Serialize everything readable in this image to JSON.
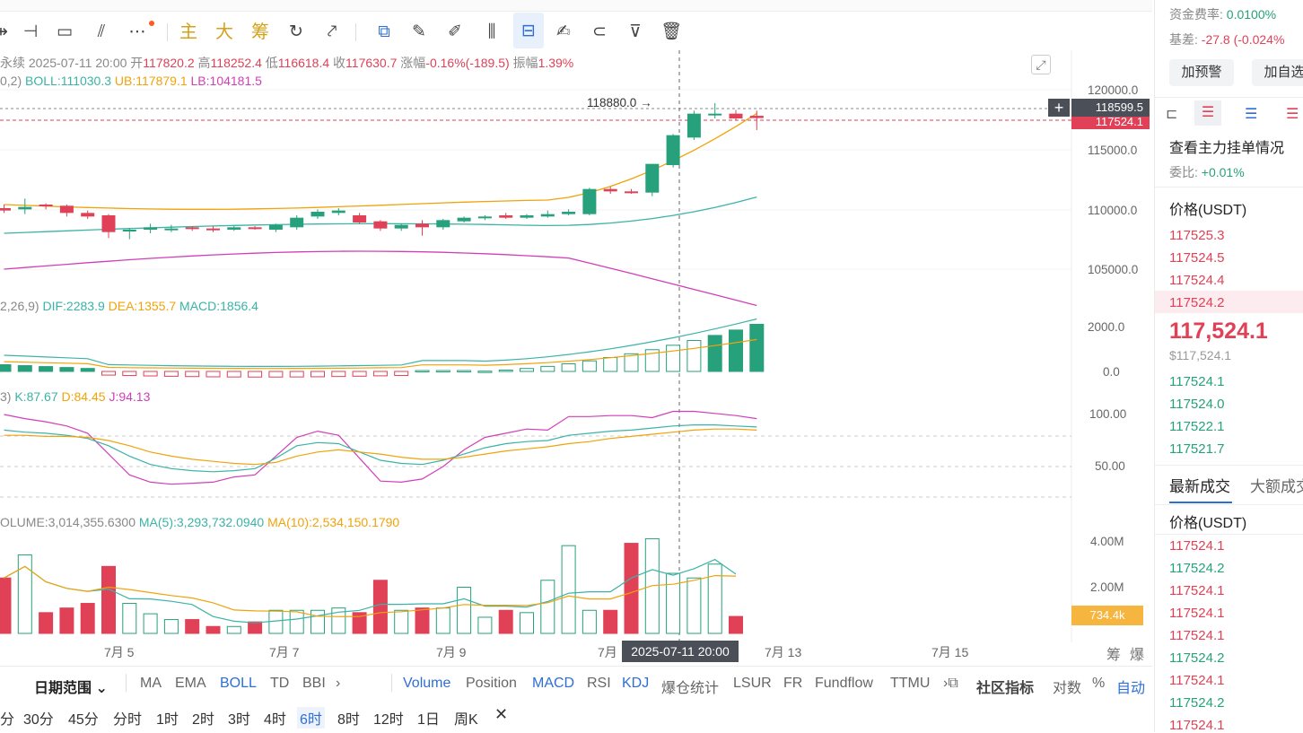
{
  "header": {
    "symbol_suffix": "永续",
    "datetime": "2025-07-11 20:00",
    "open_label": "开",
    "open": "117820.2",
    "high_label": "高",
    "high": "118252.4",
    "low_label": "低",
    "low": "116618.4",
    "close_label": "收",
    "close": "117630.7",
    "change_label": "涨幅",
    "change": "-0.16%(-189.5)",
    "amplitude_label": "振幅",
    "amplitude": "1.39%"
  },
  "toolbar": {
    "main_label": "主",
    "big_label": "大",
    "chip_label": "筹"
  },
  "boll": {
    "params": "0,2)",
    "boll": "BOLL:111030.3",
    "ub": "UB:117879.1",
    "lb": "LB:104181.5"
  },
  "macd": {
    "params": "2,26,9)",
    "dif": "DIF:2283.9",
    "dea": "DEA:1355.7",
    "macd": "MACD:1856.4"
  },
  "kdj": {
    "params": "3)",
    "k": "K:87.67",
    "d": "D:84.45",
    "j": "J:94.13"
  },
  "volume": {
    "vol": "OLUME:3,014,355.6300",
    "ma5": "MA(5):3,293,732.0940",
    "ma10": "MA(10):2,534,150.1790"
  },
  "price_axis": [
    "120000.0",
    "115000.0",
    "110000.0",
    "105000.0"
  ],
  "macd_axis": [
    "2000.0",
    "0.0"
  ],
  "kdj_axis": [
    "100.00",
    "50.00"
  ],
  "vol_axis": [
    "4.00M",
    "2.00M"
  ],
  "crosshair_price": "118599.5",
  "last_price_tag": "117524.1",
  "vol_tag": "734.4k",
  "peak_label": "118880.0",
  "date_axis": [
    "7月 5",
    "7月 7",
    "7月 9",
    "7月",
    "7月 13",
    "7月 15"
  ],
  "crosshair_date": "2025-07-11 20:00",
  "axis_corner": [
    "筹",
    "爆"
  ],
  "indicators": {
    "date_range": "日期范围",
    "items": [
      "MA",
      "EMA",
      "BOLL",
      "TD",
      "BBI",
      "Volume",
      "Position",
      "MACD",
      "RSI",
      "KDJ",
      "爆仓统计",
      "LSUR",
      "FR",
      "Fundflow",
      "TTMU",
      "社区指标",
      "对数",
      "%",
      "自动"
    ],
    "active": [
      "BOLL",
      "Volume",
      "MACD",
      "KDJ",
      "自动"
    ]
  },
  "timeframes": {
    "items": [
      "分",
      "30分",
      "45分",
      "分时",
      "1时",
      "2时",
      "3时",
      "4时",
      "6时",
      "8时",
      "12时",
      "1日",
      "周K"
    ],
    "active": "6时"
  },
  "right_panel": {
    "funding_label": "资金费率:",
    "funding_value": "0.0100%",
    "basis_label": "基差:",
    "basis_value": "-27.8 (-0.024%",
    "alert_button": "加预警",
    "watch_button": "加自选",
    "orderbook_title": "查看主力挂单情况",
    "ratio_label": "委比:",
    "ratio_value": "+0.01%",
    "price_header": "价格(USDT)",
    "asks": [
      "117525.3",
      "117524.5",
      "117524.4",
      "117524.2"
    ],
    "last_price": "117,524.1",
    "last_price_usd": "$117,524.1",
    "bids": [
      "117524.1",
      "117524.0",
      "117522.1",
      "117521.7"
    ],
    "trades_tab": "最新成交",
    "big_trades_tab": "大额成交",
    "trades_price_header": "价格(USDT)",
    "trades": [
      {
        "price": "117524.1",
        "side": "sell"
      },
      {
        "price": "117524.2",
        "side": "buy"
      },
      {
        "price": "117524.1",
        "side": "sell"
      },
      {
        "price": "117524.1",
        "side": "sell"
      },
      {
        "price": "117524.1",
        "side": "sell"
      },
      {
        "price": "117524.2",
        "side": "buy"
      },
      {
        "price": "117524.1",
        "side": "sell"
      },
      {
        "price": "117524.2",
        "side": "buy"
      },
      {
        "price": "117524.1",
        "side": "sell"
      }
    ]
  },
  "colors": {
    "up": "#26a17b",
    "down": "#e04157",
    "accent": "#2e6fd6",
    "ma_yellow": "#f0a30a",
    "ma_teal": "#3bb3a6",
    "boll_magenta": "#d13fb8"
  },
  "chart_data": {
    "type": "candlestick",
    "interval": "6时",
    "price_axis": [
      105000,
      110000,
      115000,
      120000
    ],
    "candles": [
      {
        "o": 110100,
        "h": 110400,
        "l": 109700,
        "c": 109900
      },
      {
        "o": 110000,
        "h": 110900,
        "l": 109600,
        "c": 110200
      },
      {
        "o": 110400,
        "h": 110500,
        "l": 110000,
        "c": 110300
      },
      {
        "o": 110300,
        "h": 110400,
        "l": 109400,
        "c": 109700
      },
      {
        "o": 109700,
        "h": 109900,
        "l": 109200,
        "c": 109400
      },
      {
        "o": 109500,
        "h": 109600,
        "l": 107600,
        "c": 108100
      },
      {
        "o": 108200,
        "h": 108400,
        "l": 107500,
        "c": 108300
      },
      {
        "o": 108300,
        "h": 108800,
        "l": 108000,
        "c": 108500
      },
      {
        "o": 108400,
        "h": 108700,
        "l": 108100,
        "c": 108400
      },
      {
        "o": 108500,
        "h": 108600,
        "l": 108200,
        "c": 108400
      },
      {
        "o": 108400,
        "h": 108600,
        "l": 108100,
        "c": 108300
      },
      {
        "o": 108300,
        "h": 108600,
        "l": 108200,
        "c": 108500
      },
      {
        "o": 108500,
        "h": 108600,
        "l": 108300,
        "c": 108400
      },
      {
        "o": 108300,
        "h": 108800,
        "l": 108100,
        "c": 108700
      },
      {
        "o": 108500,
        "h": 109500,
        "l": 108300,
        "c": 109300
      },
      {
        "o": 109400,
        "h": 110000,
        "l": 109200,
        "c": 109800
      },
      {
        "o": 109700,
        "h": 110100,
        "l": 109500,
        "c": 109900
      },
      {
        "o": 109500,
        "h": 109700,
        "l": 108800,
        "c": 108900
      },
      {
        "o": 109000,
        "h": 109100,
        "l": 108200,
        "c": 108400
      },
      {
        "o": 108400,
        "h": 108800,
        "l": 108200,
        "c": 108700
      },
      {
        "o": 108800,
        "h": 109100,
        "l": 107800,
        "c": 108500
      },
      {
        "o": 108500,
        "h": 109200,
        "l": 108300,
        "c": 109100
      },
      {
        "o": 109000,
        "h": 109400,
        "l": 108900,
        "c": 109300
      },
      {
        "o": 109300,
        "h": 109500,
        "l": 109100,
        "c": 109400
      },
      {
        "o": 109500,
        "h": 109700,
        "l": 109200,
        "c": 109300
      },
      {
        "o": 109300,
        "h": 109600,
        "l": 109200,
        "c": 109500
      },
      {
        "o": 109400,
        "h": 109900,
        "l": 109300,
        "c": 109600
      },
      {
        "o": 109600,
        "h": 110000,
        "l": 109500,
        "c": 109800
      },
      {
        "o": 109600,
        "h": 111800,
        "l": 109500,
        "c": 111700
      },
      {
        "o": 111700,
        "h": 111900,
        "l": 111300,
        "c": 111500
      },
      {
        "o": 111500,
        "h": 111700,
        "l": 111300,
        "c": 111400
      },
      {
        "o": 111400,
        "h": 113000,
        "l": 111100,
        "c": 113800
      },
      {
        "o": 113700,
        "h": 116300,
        "l": 113500,
        "c": 116200
      },
      {
        "o": 116000,
        "h": 118250,
        "l": 115800,
        "c": 118000
      },
      {
        "o": 118000,
        "h": 118880,
        "l": 117600,
        "c": 118000
      },
      {
        "o": 118000,
        "h": 118300,
        "l": 117400,
        "c": 117600
      },
      {
        "o": 117820,
        "h": 118252,
        "l": 116618,
        "c": 117631
      }
    ],
    "volumes": [
      2400000,
      3400000,
      900000,
      1100000,
      1300000,
      2900000,
      1300000,
      850000,
      600000,
      600000,
      300000,
      300000,
      500000,
      1000000,
      1000000,
      1000000,
      1100000,
      900000,
      2300000,
      1000000,
      1100000,
      1100000,
      2000000,
      700000,
      1000000,
      900000,
      2300000,
      3800000,
      1000000,
      1000000,
      3900000,
      4100000,
      2600000,
      2400000,
      3000000,
      734400
    ],
    "macd_axis": [
      0,
      2000
    ],
    "kdj_axis": [
      50,
      100
    ],
    "volume_axis": [
      2000000,
      4000000
    ]
  }
}
